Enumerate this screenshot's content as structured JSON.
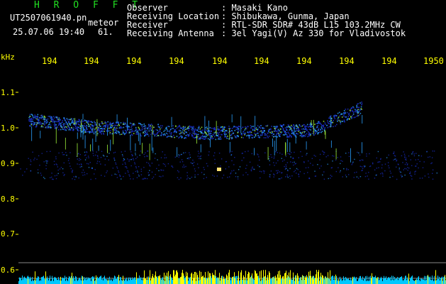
{
  "app_title": "H R O F F T",
  "file": {
    "name": "UT2507061940.pn",
    "type": "meteor",
    "datetime": "25.07.06 19:40",
    "count": "61."
  },
  "station": {
    "observer_label": "Observer",
    "observer_value": ": Masaki Kano",
    "location_label": "Receiving Location",
    "location_value": ": Shibukawa, Gunma, Japan",
    "receiver_label": "Receiver",
    "receiver_value": ": RTL-SDR SDR# 43dB L15 103.2MHz CW",
    "antenna_label": "Receiving Antenna",
    "antenna_value": ": 3el Yagi(V) Az 330 for Vladivostok"
  },
  "y_axis": {
    "unit": "kHz",
    "ticks": [
      "1.1",
      "1.0",
      "0.9",
      "0.8",
      "0.7",
      "0.6"
    ]
  },
  "x_axis": {
    "ticks": [
      "194",
      "194",
      "194",
      "194",
      "194",
      "194",
      "194",
      "194",
      "194",
      "1950"
    ]
  },
  "colors": {
    "background": "#000000",
    "axis_text": "#ffff00",
    "title": "#22e022",
    "header_text": "#ffffff",
    "signal_weak": "#1a2ec8",
    "signal_mid": "#2aa0ff",
    "signal_strong": "#9ef03a",
    "baseline_level": "#00c8ff",
    "baseline_peak": "#ffff00"
  }
}
